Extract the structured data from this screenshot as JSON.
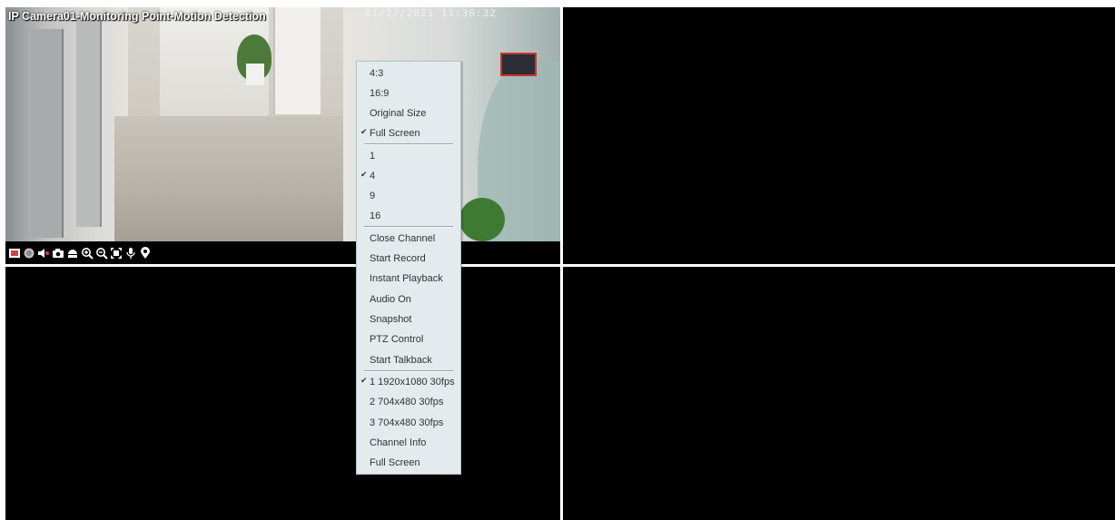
{
  "camera": {
    "title": "IP Camera01-Monitoring Point-Motion Detection",
    "timestamp": "01/27/2021 11:36:32"
  },
  "toolbar_icons": [
    "video-icon",
    "record-icon",
    "audio-icon",
    "snapshot-icon",
    "ptz-icon",
    "zoom-in-icon",
    "zoom-out-icon",
    "fullscreen-icon",
    "talkback-icon",
    "location-icon"
  ],
  "menu": {
    "aspect": [
      "4:3",
      "16:9",
      "Original Size",
      "Full Screen"
    ],
    "aspect_checked": "Full Screen",
    "layout": [
      "1",
      "4",
      "9",
      "16"
    ],
    "layout_checked": "4",
    "actions": [
      "Close Channel",
      "Start Record",
      "Instant Playback",
      "Audio On",
      "Snapshot",
      "PTZ Control",
      "Start Talkback"
    ],
    "streams": [
      "1 1920x1080 30fps",
      "2 704x480 30fps",
      "3 704x480 30fps"
    ],
    "streams_checked": "1 1920x1080 30fps",
    "tail": [
      "Channel Info",
      "Full Screen"
    ]
  }
}
